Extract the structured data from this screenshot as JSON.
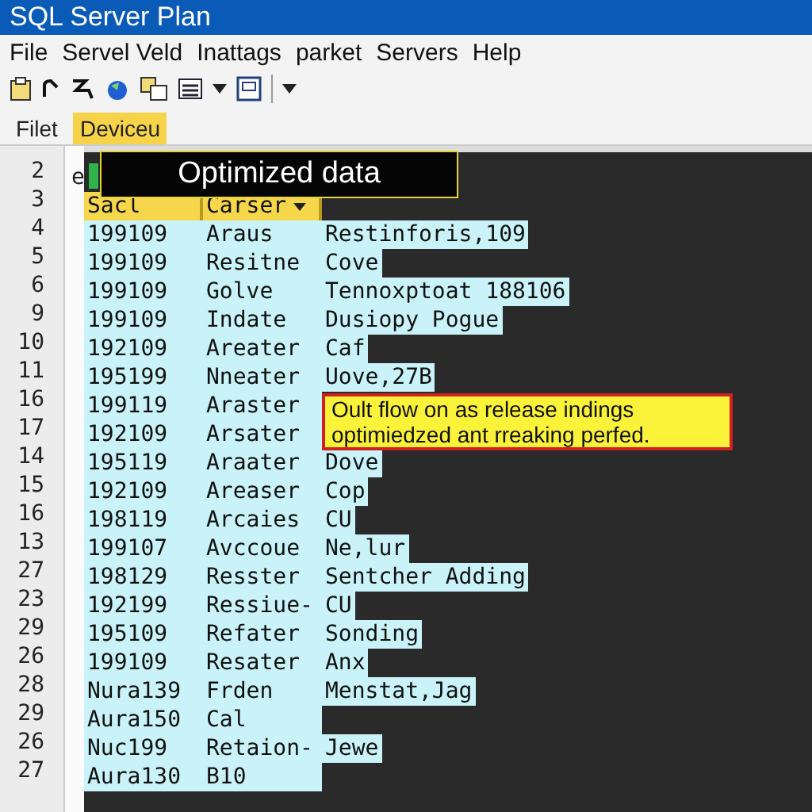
{
  "window": {
    "title": "SQL Server Plan"
  },
  "menu": [
    "File",
    "Servel Veld",
    "Inattags",
    "parket",
    "Servers",
    "Help"
  ],
  "tabs": [
    {
      "label": "Filet",
      "selected": false
    },
    {
      "label": "Deviceu",
      "selected": true
    }
  ],
  "editor": {
    "lines": [
      {
        "number": "2",
        "kind": "code",
        "text": "e"
      },
      {
        "number": "3",
        "kind": "header",
        "cells": [
          "Sacl",
          "Carser"
        ]
      },
      {
        "number": "4",
        "kind": "row",
        "cells": [
          "199109",
          "Araus",
          "Restinforis,109"
        ]
      },
      {
        "number": "5",
        "kind": "row",
        "cells": [
          "199109",
          "Resitne",
          "Cove"
        ]
      },
      {
        "number": "6",
        "kind": "row",
        "cells": [
          "199109",
          "Golve",
          "Tennoxptoat 188106"
        ]
      },
      {
        "number": "9",
        "kind": "row",
        "cells": [
          "199109",
          "Indate",
          "Dusiopy Pogue"
        ]
      },
      {
        "number": "10",
        "kind": "row",
        "cells": [
          "192109",
          "Areater",
          "Caf"
        ]
      },
      {
        "number": "11",
        "kind": "row",
        "cells": [
          "195199",
          "Nneater",
          "Uove,27B"
        ]
      },
      {
        "number": "16",
        "kind": "row",
        "cells": [
          "199119",
          "Araster"
        ]
      },
      {
        "number": "17",
        "kind": "row",
        "cells": [
          "192109",
          "Arsater"
        ]
      },
      {
        "number": "14",
        "kind": "row",
        "cells": [
          "195119",
          "Araater",
          "Dove"
        ]
      },
      {
        "number": "15",
        "kind": "row",
        "cells": [
          "192109",
          "Areaser",
          "Cop"
        ]
      },
      {
        "number": "16",
        "kind": "row",
        "cells": [
          "198119",
          "Arcaies",
          "CU"
        ]
      },
      {
        "number": "13",
        "kind": "row",
        "cells": [
          "199107",
          "Avccoue",
          "Ne,lur"
        ]
      },
      {
        "number": "27",
        "kind": "row",
        "cells": [
          "198129",
          "Resster",
          "Sentcher Adding"
        ]
      },
      {
        "number": "23",
        "kind": "row",
        "cells": [
          "192199",
          "Ressiue-",
          "CU"
        ]
      },
      {
        "number": "29",
        "kind": "row",
        "cells": [
          "195109",
          "Refater",
          "Sonding"
        ]
      },
      {
        "number": "26",
        "kind": "row",
        "cells": [
          "199109",
          "Resater",
          "Anx"
        ]
      },
      {
        "number": "28",
        "kind": "row",
        "cells": [
          "Nura139",
          "Frden",
          "Menstat,Jag"
        ]
      },
      {
        "number": "29",
        "kind": "row",
        "cells": [
          "Aura150",
          "Cal"
        ]
      },
      {
        "number": "26",
        "kind": "row",
        "cells": [
          "Nuc199",
          "Retaion-",
          "Jewe"
        ]
      },
      {
        "number": "27",
        "kind": "row",
        "cells": [
          "Aura130",
          "B10"
        ]
      }
    ]
  },
  "banner": {
    "text": "Optimized data"
  },
  "callout": {
    "lines": [
      "Oult flow on as release indings",
      "optimiedzed ant rreaking perfed."
    ]
  }
}
